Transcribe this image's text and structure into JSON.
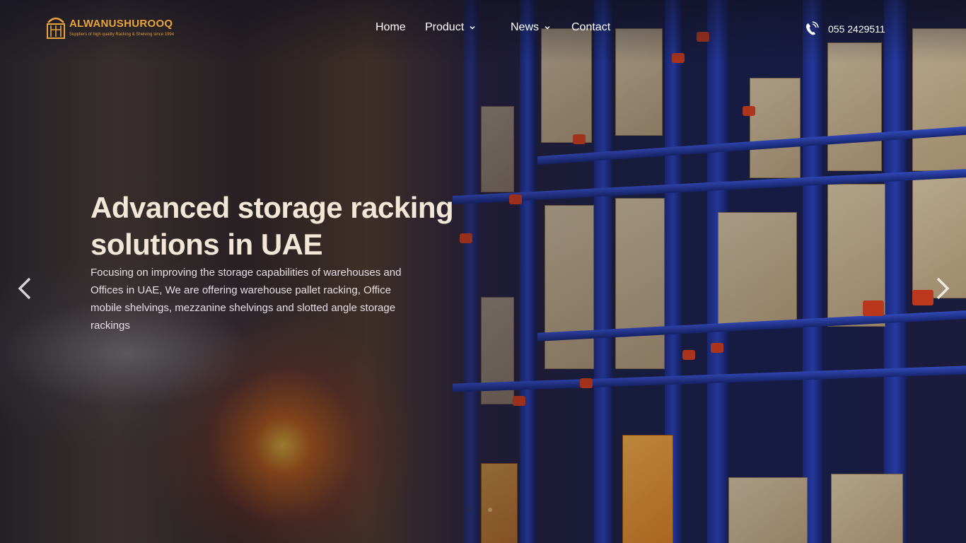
{
  "brand": {
    "name": "ALWANUSHUROOQ",
    "tagline": "Suppliers of high quality Racking & Shelving since 1994",
    "accent_color": "#e8a33a"
  },
  "nav": {
    "items": [
      {
        "label": "Home",
        "has_dropdown": false
      },
      {
        "label": "Product",
        "has_dropdown": true
      },
      {
        "label": "News",
        "has_dropdown": true
      },
      {
        "label": "Contact",
        "has_dropdown": false
      }
    ],
    "dropdown_icon": "chevron-down-icon"
  },
  "contact": {
    "phone": "055 2429511",
    "icon": "phone-icon"
  },
  "hero": {
    "title": "Advanced storage racking solutions in UAE",
    "description": "Focusing on improving the storage capabilities of warehouses and Offices in UAE, We are offering warehouse pallet racking, Office mobile shelvings, mezzanine shelvings and slotted angle storage rackings",
    "prev_icon": "chevron-left-icon",
    "next_icon": "chevron-right-icon",
    "slide_count": 2,
    "active_slide": 1
  }
}
